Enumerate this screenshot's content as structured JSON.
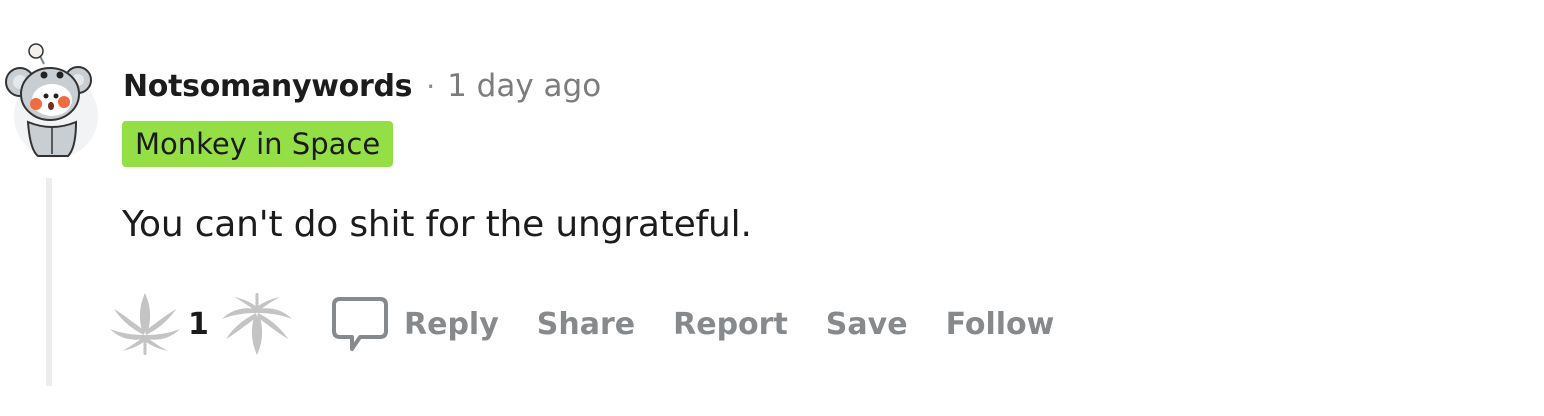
{
  "comment": {
    "author": "Notsomanywords",
    "separator": "·",
    "timestamp": "1 day ago",
    "flair": "Monkey in Space",
    "body": "You can't do shit for the ungrateful.",
    "score": "1"
  },
  "actions": {
    "reply": "Reply",
    "share": "Share",
    "report": "Report",
    "save": "Save",
    "follow": "Follow"
  },
  "icons": {
    "upvote": "leaf-upvote-icon",
    "downvote": "leaf-downvote-icon",
    "reply": "speech-bubble-icon"
  },
  "colors": {
    "flair_bg": "#94e044",
    "muted_text": "#878a8c",
    "vote_icon": "#c4c4c4",
    "thread_line": "#ededed"
  }
}
